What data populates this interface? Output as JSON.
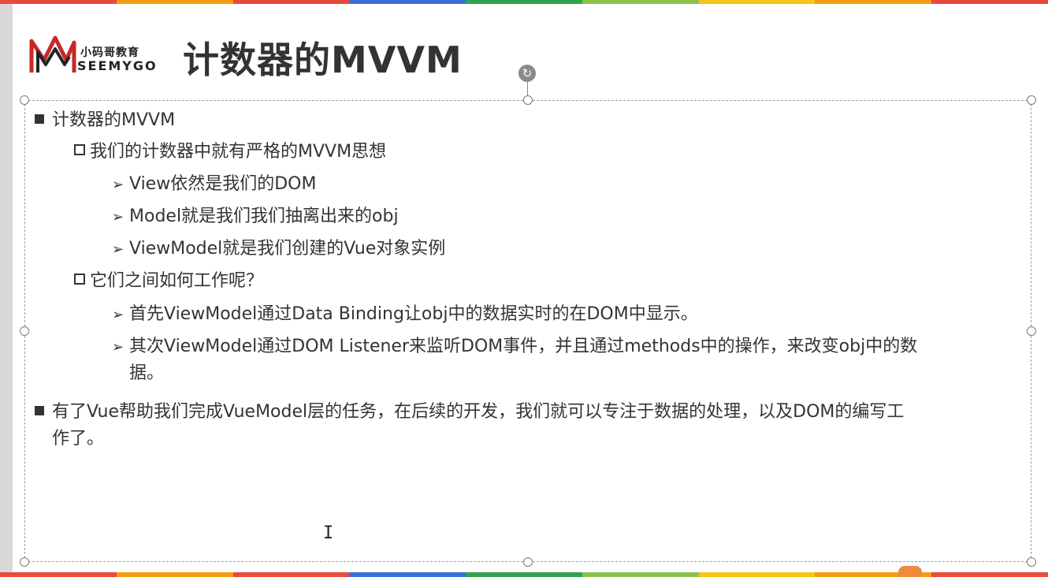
{
  "colors": {
    "strip": [
      "#e84a3c",
      "#f39c12",
      "#e84a3c",
      "#3a6fd8",
      "#2ea44f",
      "#8bc34a",
      "#f5c518",
      "#f39c12",
      "#e84a3c"
    ],
    "text": "#333333"
  },
  "logo": {
    "cn": "小码哥教育",
    "en": "SEEMYGO",
    "icon": "seemygo-logo-icon"
  },
  "slide": {
    "title": "计数器的MVVM"
  },
  "bullets": {
    "l1_1": "计数器的MVVM",
    "l2_1": "我们的计数器中就有严格的MVVM思想",
    "l3_1": "View依然是我们的DOM",
    "l3_2": "Model就是我们我们抽离出来的obj",
    "l3_3": "ViewModel就是我们创建的Vue对象实例",
    "l2_2": "它们之间如何工作呢？",
    "l3_4": "首先ViewModel通过Data Binding让obj中的数据实时的在DOM中显示。",
    "l3_5a": "其次ViewModel通过DOM Listener来监听DOM事件，并且通过methods中的操作，来改变obj中的数",
    "l3_5b": "据。",
    "l1_2a": "有了Vue帮助我们完成VueModel层的任务，在后续的开发，我们就可以专注于数据的处理，以及DOM的编写工",
    "l1_2b": "作了。"
  },
  "icons": {
    "rotate": "rotate-handle-icon",
    "cursor": "text-cursor-icon"
  }
}
